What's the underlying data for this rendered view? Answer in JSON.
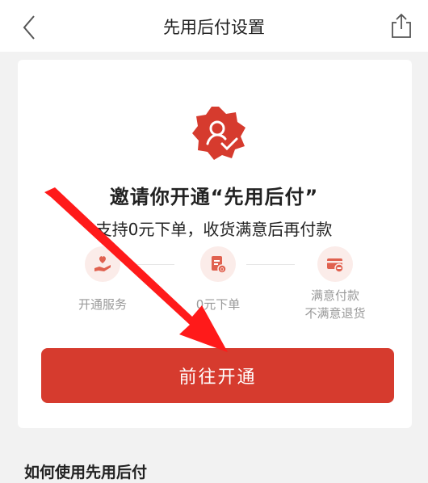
{
  "navbar": {
    "title": "先用后付设置",
    "back_icon": "chevron-left-icon",
    "share_icon": "share-icon"
  },
  "card": {
    "badge_icon": "user-verified-badge-icon",
    "title": "邀请你开通“先用后付”",
    "subtitle": "支持0元下单，收货满意后再付款",
    "steps": [
      {
        "icon": "hand-heart-icon",
        "label": "开通服务"
      },
      {
        "icon": "order-document-icon",
        "label": "0元下单"
      },
      {
        "icon": "card-refund-icon",
        "label": "满意付款",
        "label2": "不满意退货"
      }
    ],
    "cta_label": "前往开通"
  },
  "howto_title": "如何使用先用后付",
  "colors": {
    "accent": "#d63b2e",
    "annotation_arrow": "#ff1a1a"
  }
}
